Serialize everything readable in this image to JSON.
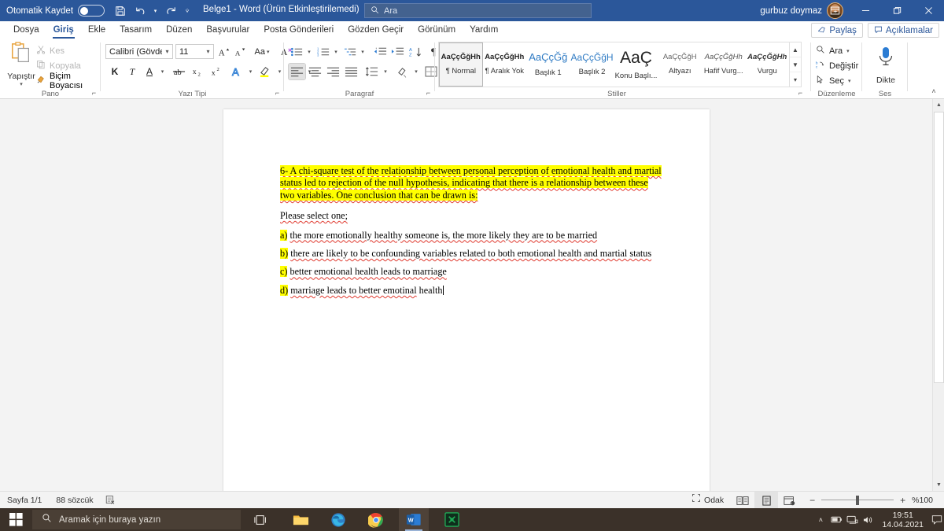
{
  "titlebar": {
    "autosave_label": "Otomatik Kaydet",
    "autosave_state": "off",
    "save_icon": "save-icon",
    "undo_icon": "undo-icon",
    "redo_icon": "redo-icon",
    "customize_icon": "customize-quick-access-icon",
    "document_title": "Belge1  -  Word (Ürün Etkinleştirilemedi)",
    "search_placeholder": "Ara",
    "search_icon": "search-icon",
    "account_name": "gurbuz doymaz",
    "ribbon_display_icon": "ribbon-display-options-icon",
    "minimize_icon": "minimize-icon",
    "restore_icon": "restore-icon",
    "close_icon": "close-icon"
  },
  "tabs": [
    {
      "label": "Dosya",
      "active": false
    },
    {
      "label": "Giriş",
      "active": true
    },
    {
      "label": "Ekle",
      "active": false
    },
    {
      "label": "Tasarım",
      "active": false
    },
    {
      "label": "Düzen",
      "active": false
    },
    {
      "label": "Başvurular",
      "active": false
    },
    {
      "label": "Posta Gönderileri",
      "active": false
    },
    {
      "label": "Gözden Geçir",
      "active": false
    },
    {
      "label": "Görünüm",
      "active": false
    },
    {
      "label": "Yardım",
      "active": false
    }
  ],
  "tab_actions": {
    "share_label": "Paylaş",
    "share_icon": "share-icon",
    "comments_label": "Açıklamalar",
    "comments_icon": "comment-icon"
  },
  "ribbon": {
    "clipboard": {
      "group_label": "Pano",
      "paste_label": "Yapıştır",
      "paste_icon": "paste-icon",
      "items": [
        {
          "label": "Kes",
          "icon": "scissors-icon",
          "disabled": true
        },
        {
          "label": "Kopyala",
          "icon": "copy-icon",
          "disabled": true
        },
        {
          "label": "Biçim Boyacısı",
          "icon": "format-painter-icon",
          "disabled": false
        }
      ]
    },
    "font": {
      "group_label": "Yazı Tipi",
      "font_family": "Calibri (Gövde)",
      "font_size": "11",
      "grow_font_icon": "grow-font-icon",
      "shrink_font_icon": "shrink-font-icon",
      "change_case_label": "Aa",
      "clear_formatting_icon": "clear-formatting-icon",
      "bold_label": "K",
      "italic_label": "T",
      "underline_label": "A",
      "strikethrough_icon": "strikethrough-icon",
      "subscript_label": "x",
      "superscript_label": "x",
      "text_effects_icon": "text-effects-icon",
      "highlight_icon": "text-highlight-icon",
      "highlight_color": "#ffff00",
      "font_color_icon": "font-color-icon",
      "font_color": "#e02020"
    },
    "paragraph": {
      "group_label": "Paragraf",
      "bullets_icon": "bullets-icon",
      "numbering_icon": "numbering-icon",
      "multilevel_icon": "multilevel-list-icon",
      "decrease_indent_icon": "decrease-indent-icon",
      "increase_indent_icon": "increase-indent-icon",
      "sort_icon": "sort-icon",
      "show_marks_icon": "show-formatting-marks-icon",
      "align_left_icon": "align-left-icon",
      "align_center_icon": "align-center-icon",
      "align_right_icon": "align-right-icon",
      "justify_icon": "justify-icon",
      "line_spacing_icon": "line-spacing-icon",
      "shading_icon": "shading-icon",
      "borders_icon": "borders-icon"
    },
    "styles": {
      "group_label": "Stiller",
      "items": [
        {
          "preview": "AaÇçĞğHh",
          "name": "¶ Normal",
          "active": true,
          "style": "normal"
        },
        {
          "preview": "AaÇçĞğHh",
          "name": "¶ Aralık Yok",
          "active": false,
          "style": "normal"
        },
        {
          "preview": "AaÇçĞğ",
          "name": "Başlık 1",
          "active": false,
          "style": "heading1"
        },
        {
          "preview": "AaÇçĞğH",
          "name": "Başlık 2",
          "active": false,
          "style": "heading2"
        },
        {
          "preview": "AaÇ",
          "name": "Konu Başlı...",
          "active": false,
          "style": "title"
        },
        {
          "preview": "AaÇçĞğH",
          "name": "Altyazı",
          "active": false,
          "style": "subtitle"
        },
        {
          "preview": "AaÇçĞğHh",
          "name": "Hafif Vurg...",
          "active": false,
          "style": "subtle-emphasis"
        },
        {
          "preview": "AaÇçĞğHh",
          "name": "Vurgu",
          "active": false,
          "style": "emphasis"
        }
      ],
      "scroll_up_icon": "scroll-up-icon",
      "scroll_down_icon": "scroll-down-icon",
      "more_icon": "more-styles-icon"
    },
    "editing": {
      "group_label": "Düzenleme",
      "items": [
        {
          "label": "Ara",
          "icon": "search-icon",
          "has_caret": true
        },
        {
          "label": "Değiştir",
          "icon": "replace-icon",
          "has_caret": false
        },
        {
          "label": "Seç",
          "icon": "select-icon",
          "has_caret": true
        }
      ]
    },
    "voice": {
      "group_label": "Ses",
      "dictate_label": "Dikte",
      "dictate_icon": "microphone-icon"
    },
    "collapse_icon": "collapse-ribbon-icon"
  },
  "document": {
    "question": {
      "segments": [
        {
          "text": "6- A ",
          "hl": true,
          "sq": false
        },
        {
          "text": "chi-square",
          "hl": true,
          "sq": true
        },
        {
          "text": " test of ",
          "hl": true,
          "sq": false
        },
        {
          "text": "the relationship between personal perception",
          "hl": true,
          "sq": true
        },
        {
          "text": " of ",
          "hl": true,
          "sq": false
        },
        {
          "text": "emotional health and martial status led to rejection",
          "hl": true,
          "sq": true
        },
        {
          "text": " of ",
          "hl": true,
          "sq": false
        },
        {
          "text": "the null hypothesis, indicating that there",
          "hl": true,
          "sq": true
        },
        {
          "text": " is a ",
          "hl": true,
          "sq": false
        },
        {
          "text": "relationship between these two variables. One conclusion that",
          "hl": true,
          "sq": true
        },
        {
          "text": " can be ",
          "hl": true,
          "sq": false
        },
        {
          "text": "drawn",
          "hl": true,
          "sq": true
        },
        {
          "text": " is:",
          "hl": true,
          "sq": false
        }
      ]
    },
    "prompt": "Please select one;",
    "options": [
      {
        "marker": "a)",
        "segments": [
          {
            "text": " ",
            "sq": false
          },
          {
            "text": "the more emotionally healthy someone",
            "sq": true
          },
          {
            "text": " is, ",
            "sq": false
          },
          {
            "text": "the more likely they are to",
            "sq": true
          },
          {
            "text": " be ",
            "sq": false
          },
          {
            "text": "married",
            "sq": true
          }
        ]
      },
      {
        "marker": "b)",
        "segments": [
          {
            "text": " ",
            "sq": false
          },
          {
            "text": "there are likely to",
            "sq": true
          },
          {
            "text": " be ",
            "sq": false
          },
          {
            "text": "confounding variables related to both emotional health and martial status",
            "sq": true
          }
        ]
      },
      {
        "marker": "c)",
        "segments": [
          {
            "text": " ",
            "sq": false
          },
          {
            "text": "better emotional health leads to marriage",
            "sq": true
          }
        ]
      },
      {
        "marker": "d)",
        "segments": [
          {
            "text": " ",
            "sq": false
          },
          {
            "text": "marriage leads to better emotinal",
            "sq": true
          },
          {
            "text": " health",
            "sq": false
          }
        ],
        "caret": true
      }
    ],
    "highlight_color": "#ffff00",
    "spellcheck_color": "#e03a2f"
  },
  "statusbar": {
    "page_label": "Sayfa 1/1",
    "word_count": "88 sözcük",
    "proofing_icon": "proofing-errors-icon",
    "focus_label": "Odak",
    "focus_icon": "focus-mode-icon",
    "read_mode_icon": "read-mode-icon",
    "print_layout_icon": "print-layout-icon",
    "web_layout_icon": "web-layout-icon",
    "zoom_out": "−",
    "zoom_in": "+",
    "zoom_level": "%100"
  },
  "taskbar": {
    "start_icon": "windows-start-icon",
    "search_placeholder": "Aramak için buraya yazın",
    "search_icon": "search-icon",
    "taskview_icon": "task-view-icon",
    "apps": [
      {
        "name": "file-explorer-icon",
        "open": false
      },
      {
        "name": "microsoft-edge-icon",
        "open": false
      },
      {
        "name": "google-chrome-icon",
        "open": false
      },
      {
        "name": "microsoft-word-icon",
        "open": true
      },
      {
        "name": "app-green-icon",
        "open": false
      }
    ],
    "tray": {
      "expand_icon": "show-hidden-icons-icon",
      "battery_icon": "battery-icon",
      "network_icon": "network-icon",
      "volume_icon": "volume-icon",
      "time": "19:51",
      "date": "14.04.2021",
      "action_center_icon": "action-center-icon"
    }
  },
  "colors": {
    "word_blue": "#2b579a",
    "ribbon_bg": "#ffffff",
    "doc_bg": "#f3f3f3",
    "taskbar_bg": "#3b3129"
  }
}
